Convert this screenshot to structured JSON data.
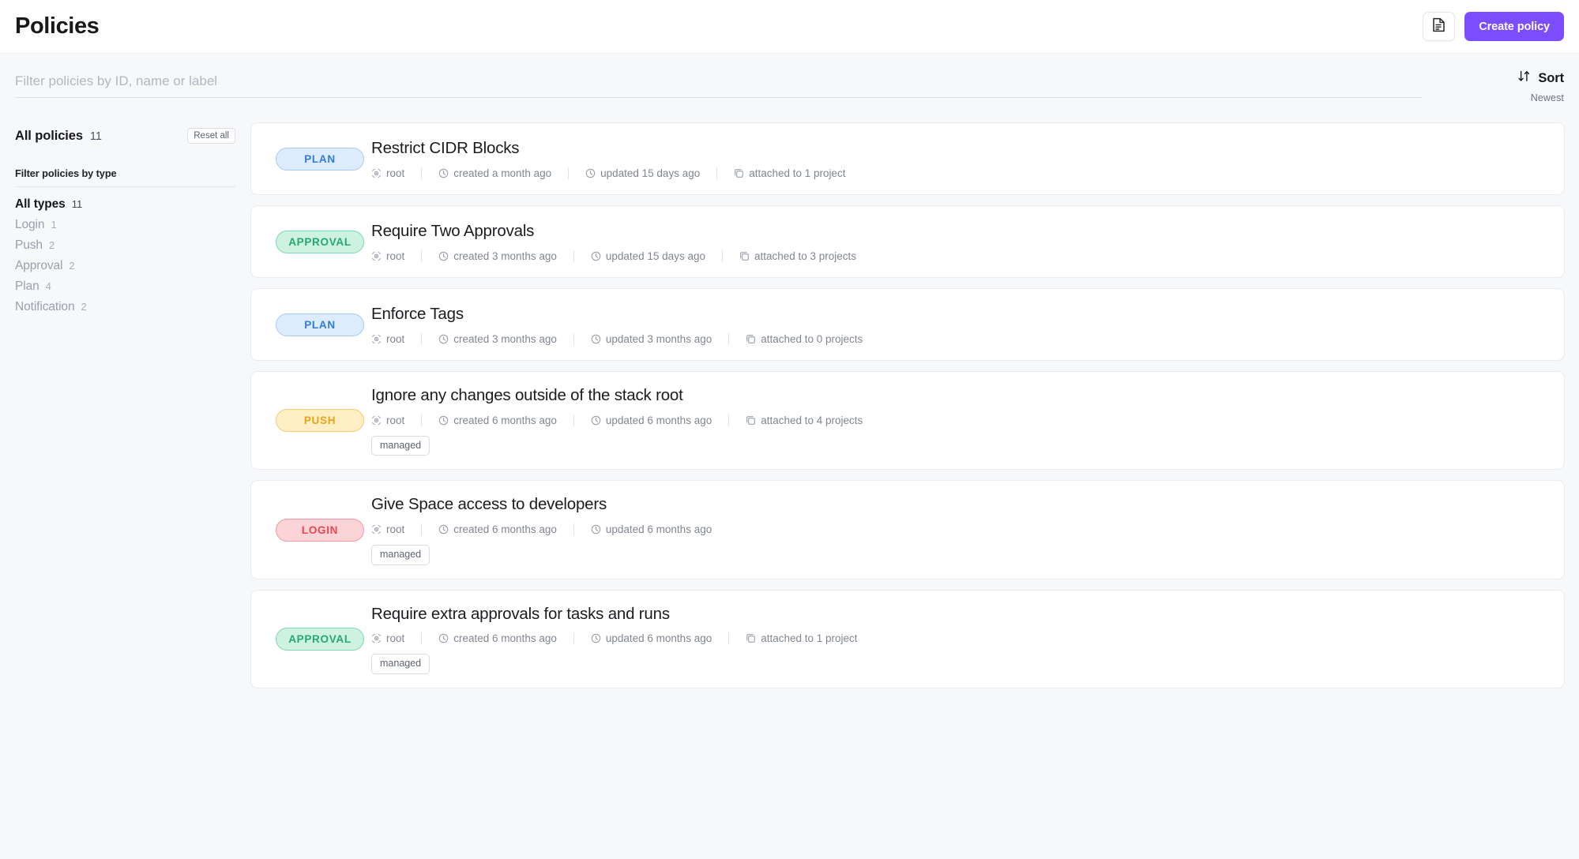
{
  "header": {
    "title": "Policies",
    "doc_icon": "document-icon",
    "create_button": "Create policy"
  },
  "search": {
    "placeholder": "Filter policies by ID, name or label",
    "value": ""
  },
  "sort": {
    "icon": "sort-arrows-icon",
    "label": "Sort",
    "value": "Newest"
  },
  "sidebar": {
    "title": "All policies",
    "count": "11",
    "reset_label": "Reset all",
    "section_label": "Filter policies by type",
    "types": [
      {
        "name": "All types",
        "count": "11",
        "active": true
      },
      {
        "name": "Login",
        "count": "1",
        "active": false
      },
      {
        "name": "Push",
        "count": "2",
        "active": false
      },
      {
        "name": "Approval",
        "count": "2",
        "active": false
      },
      {
        "name": "Plan",
        "count": "4",
        "active": false
      },
      {
        "name": "Notification",
        "count": "2",
        "active": false
      }
    ]
  },
  "policies": [
    {
      "type": "PLAN",
      "name": "Restrict CIDR Blocks",
      "space": "root",
      "created": "created a month ago",
      "updated": "updated 15 days ago",
      "attached": "attached to 1 project",
      "labels": []
    },
    {
      "type": "APPROVAL",
      "name": "Require Two Approvals",
      "space": "root",
      "created": "created 3 months ago",
      "updated": "updated 15 days ago",
      "attached": "attached to 3 projects",
      "labels": []
    },
    {
      "type": "PLAN",
      "name": "Enforce Tags",
      "space": "root",
      "created": "created 3 months ago",
      "updated": "updated 3 months ago",
      "attached": "attached to 0 projects",
      "labels": []
    },
    {
      "type": "PUSH",
      "name": "Ignore any changes outside of the stack root",
      "space": "root",
      "created": "created 6 months ago",
      "updated": "updated 6 months ago",
      "attached": "attached to 4 projects",
      "labels": [
        "managed"
      ]
    },
    {
      "type": "LOGIN",
      "name": "Give Space access to developers",
      "space": "root",
      "created": "created 6 months ago",
      "updated": "updated 6 months ago",
      "attached": null,
      "labels": [
        "managed"
      ]
    },
    {
      "type": "APPROVAL",
      "name": "Require extra approvals for tasks and runs",
      "space": "root",
      "created": "created 6 months ago",
      "updated": "updated 6 months ago",
      "attached": "attached to 1 project",
      "labels": [
        "managed"
      ]
    }
  ],
  "colors": {
    "accent": "#7c4dff",
    "page_bg": "#f7f8fa",
    "card_bg": "#ffffff",
    "plan": "#2f7be0",
    "approval": "#24a86e",
    "push": "#e8a317",
    "login": "#e8474f"
  },
  "icons": {
    "space": "space-icon",
    "created": "clock-icon",
    "updated": "clock-icon",
    "attached": "stack-copy-icon"
  }
}
